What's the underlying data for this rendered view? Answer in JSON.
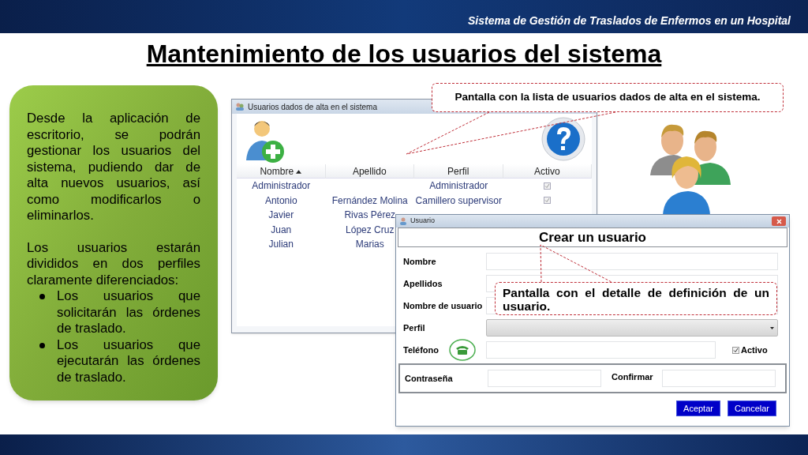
{
  "header": {
    "subtitle": "Sistema de Gestión de Traslados de Enfermos en un Hospital"
  },
  "title": "Mantenimiento de los usuarios del sistema",
  "info_card": {
    "paragraphs": [
      "Desde la aplicación de escritorio, se podrán gestionar los usuarios del sistema, pudiendo dar de alta nuevos usuarios, así como modificarlos o eliminarlos.",
      "Los usuarios estarán divididos en dos perfiles claramente diferenciados:"
    ],
    "bullets": [
      "Los usuarios que solicitarán las órdenes de traslado.",
      "Los usuarios que ejecutarán las órdenes de traslado."
    ]
  },
  "callouts": [
    {
      "text": "Pantalla con la lista de usuarios dados de alta en el sistema."
    },
    {
      "text": "Pantalla con el detalle de definición de un usuario."
    }
  ],
  "users_window": {
    "title": "Usuarios dados de alta en el sistema",
    "columns": [
      {
        "label": "Nombre",
        "sorted": true
      },
      {
        "label": "Apellido",
        "sorted": false
      },
      {
        "label": "Perfil",
        "sorted": false
      },
      {
        "label": "Activo",
        "sorted": false
      }
    ],
    "rows": [
      {
        "nombre": "Administrador",
        "perfil": "Administrador",
        "activo": true
      },
      {
        "nombre": "Antonio",
        "apellido": "Fernández Molina",
        "perfil": "Camillero supervisor",
        "activo": true
      },
      {
        "nombre": "Javier",
        "apellido": "Rivas Pérez"
      },
      {
        "nombre": "Juan",
        "apellido": "López Cruz"
      },
      {
        "nombre": "Julian",
        "apellido": "Marias"
      }
    ]
  },
  "user_dialog": {
    "title": "Usuario",
    "heading": "Crear un usuario",
    "fields": [
      {
        "label": "Nombre",
        "kind": "text"
      },
      {
        "label": "Apellidos",
        "kind": "text"
      },
      {
        "label": "Nombre de usuario",
        "kind": "text"
      },
      {
        "label": "Perfil",
        "kind": "select"
      },
      {
        "label": "Teléfono",
        "kind": "phone"
      }
    ],
    "active": {
      "label": "Activo",
      "checked": true
    },
    "password": {
      "label": "Contraseña"
    },
    "confirm": {
      "label": "Confirmar"
    },
    "buttons": [
      "Aceptar",
      "Cancelar"
    ]
  }
}
